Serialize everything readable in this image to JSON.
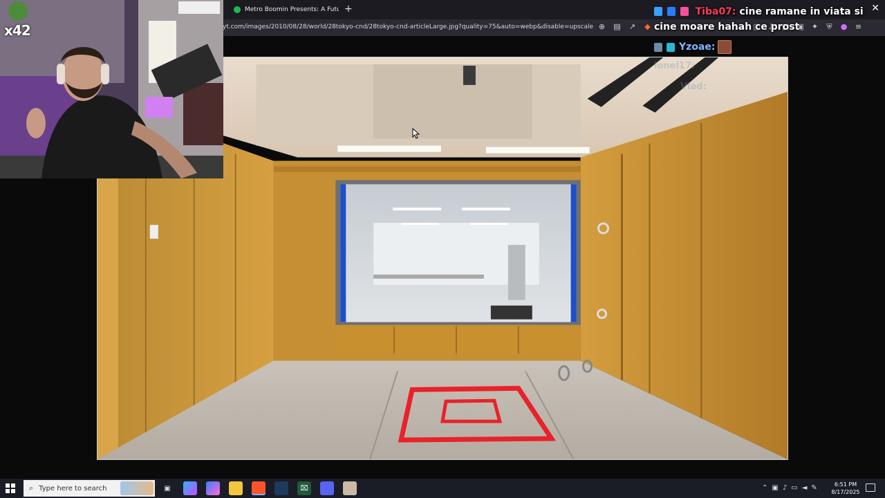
{
  "browser": {
    "tab_title": "Metro Boomin Presents: A Futuristic",
    "new_tab_icon": "+",
    "close_icon": "✕",
    "url": "yt.com/images/2010/08/28/world/28tokyo-cnd/28tokyo-cnd-articleLarge.jpg?quality=75&auto=webp&disable=upscale"
  },
  "stream": {
    "channel_logo": "x42"
  },
  "chat": {
    "message1_user": "Tiba07:",
    "message1_text": "cine ramane in viata si cine moare hahah ce prost",
    "message2_user": "Yzoae:",
    "ghost1": "lonel17:",
    "ghost2": "Vlad:"
  },
  "taskbar": {
    "search_placeholder": "Type here to search",
    "time": "6:51 PM",
    "date": "8/17/2025"
  },
  "colors": {
    "accent_red": "#e8222a",
    "chat_user_red": "#ff3b5c",
    "chat_user_blue": "#7fb6ff",
    "wood": "#c8902f"
  }
}
